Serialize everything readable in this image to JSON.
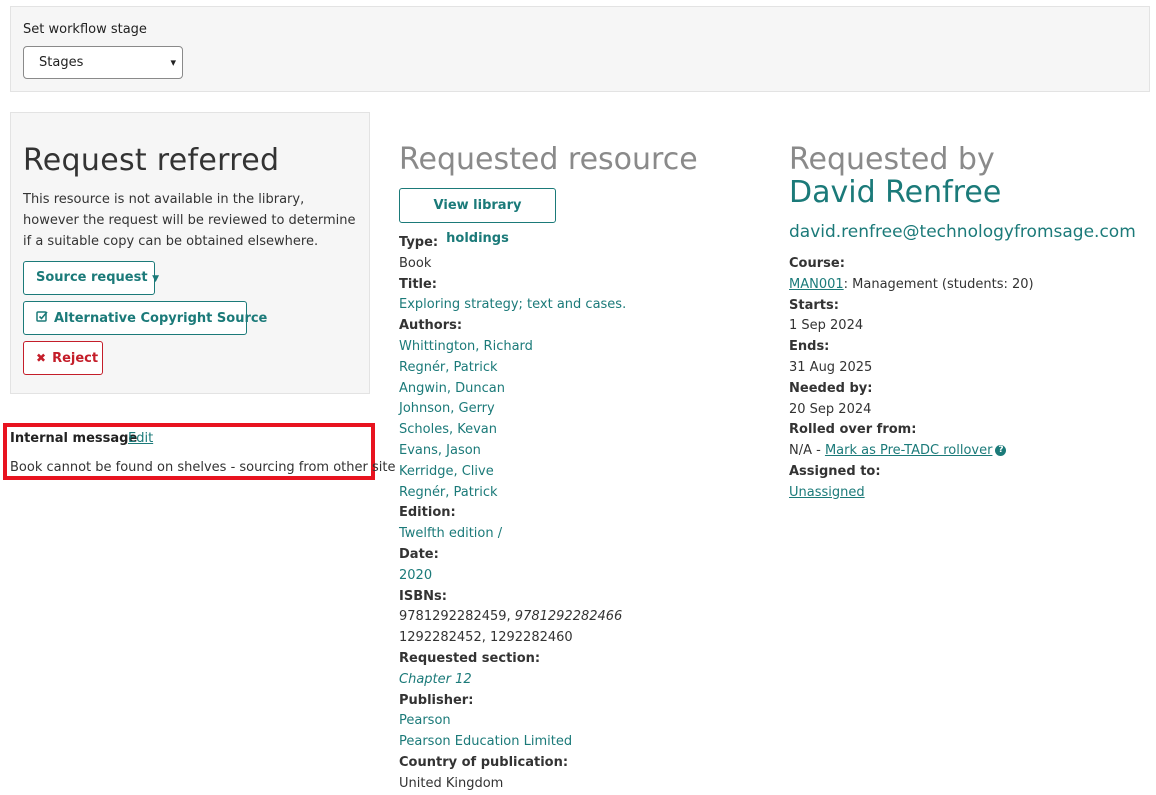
{
  "workflow": {
    "label": "Set workflow stage",
    "select_value": "Stages"
  },
  "referred": {
    "title": "Request referred",
    "description": "This resource is not available in the library, however the request will be reviewed to determine if a suitable copy can be obtained elsewhere.",
    "source_button": "Source request",
    "alt_copyright_button": "Alternative Copyright Source",
    "reject_button": "Reject"
  },
  "internal_message": {
    "label": "Internal message",
    "edit_label": "Edit",
    "text": "Book cannot be found on shelves - sourcing from other site"
  },
  "resource": {
    "title": "Requested resource",
    "holdings_button": "View library holdings",
    "type_label": "Type:",
    "type": "Book",
    "title_label": "Title:",
    "book_title": "Exploring strategy; text and cases.",
    "authors_label": "Authors:",
    "authors": [
      "Whittington, Richard",
      "Regnér, Patrick",
      "Angwin, Duncan",
      "Johnson, Gerry",
      "Scholes, Kevan",
      "Evans, Jason",
      "Kerridge, Clive",
      "Regnér, Patrick"
    ],
    "edition_label": "Edition:",
    "edition": "Twelfth edition /",
    "date_label": "Date:",
    "date": "2020",
    "isbns_label": "ISBNs:",
    "isbn_1": "9781292282459",
    "isbn_sep": ", ",
    "isbn_2": "9781292282466",
    "isbn_line2": "1292282452, 1292282460",
    "section_label": "Requested section:",
    "section": "Chapter 12",
    "publisher_label": "Publisher:",
    "publishers": [
      "Pearson",
      "Pearson Education Limited"
    ],
    "country_label": "Country of publication:",
    "country": "United Kingdom"
  },
  "requester": {
    "heading": "Requested by",
    "name": "David Renfree",
    "email": "david.renfree@technologyfromsage.com",
    "course_label": "Course:",
    "course_code": "MAN001",
    "course_desc": ": Management (students: 20)",
    "starts_label": "Starts:",
    "starts": "1 Sep 2024",
    "ends_label": "Ends:",
    "ends": "31 Aug 2025",
    "needed_label": "Needed by:",
    "needed": "20 Sep 2024",
    "rolled_label": "Rolled over from:",
    "rolled_prefix": "N/A - ",
    "rollover_link": "Mark as Pre-TADC rollover",
    "assigned_label": "Assigned to:",
    "assigned": "Unassigned"
  },
  "colors": {
    "accent": "#1b7a79",
    "danger": "#c41e2a",
    "highlight": "#e8131f",
    "panel_bg": "#f6f6f6"
  },
  "icons": {
    "select_caret": "chevron-down-icon",
    "source_caret": "caret-down-icon",
    "alt_copyright": "checkbox-edit-icon",
    "reject": "close-icon",
    "rollover_help": "question-circle-icon"
  }
}
